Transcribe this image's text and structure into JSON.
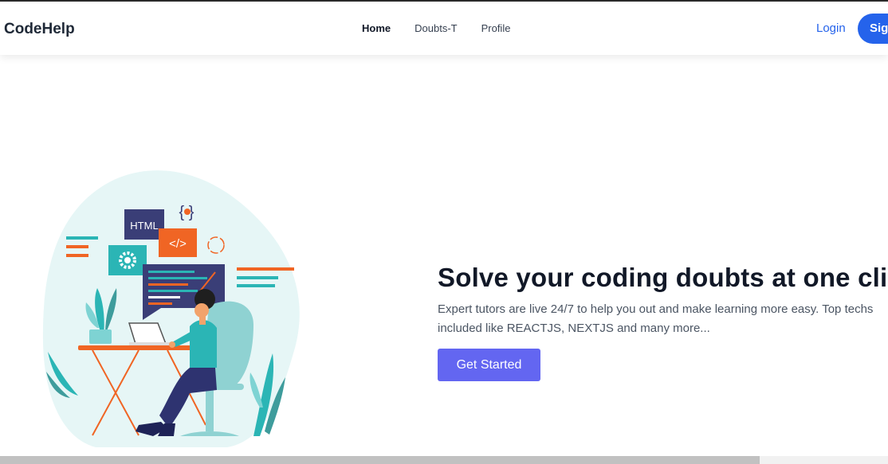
{
  "navbar": {
    "brand": "CodeHelp",
    "links": [
      "Home",
      "Doubts-T",
      "Profile"
    ],
    "login": "Login",
    "signup": "Sig"
  },
  "illustration": {
    "html_tag": "HTML",
    "code_tag": "</>",
    "braces": "{ }"
  },
  "hero": {
    "title": "Solve your coding doubts at one click",
    "description": "Expert tutors are live 24/7 to help you out and make learning more easy. Top techs included like REACTJS, NEXTJS and many more...",
    "cta": "Get Started"
  },
  "colors": {
    "primary_blue": "#2563eb",
    "cta_indigo": "#6366f1",
    "teal": "#2bb5b5",
    "orange": "#f06524",
    "navy": "#3a3e77"
  },
  "scrollbar": {
    "horizontal_position": 0.86
  }
}
